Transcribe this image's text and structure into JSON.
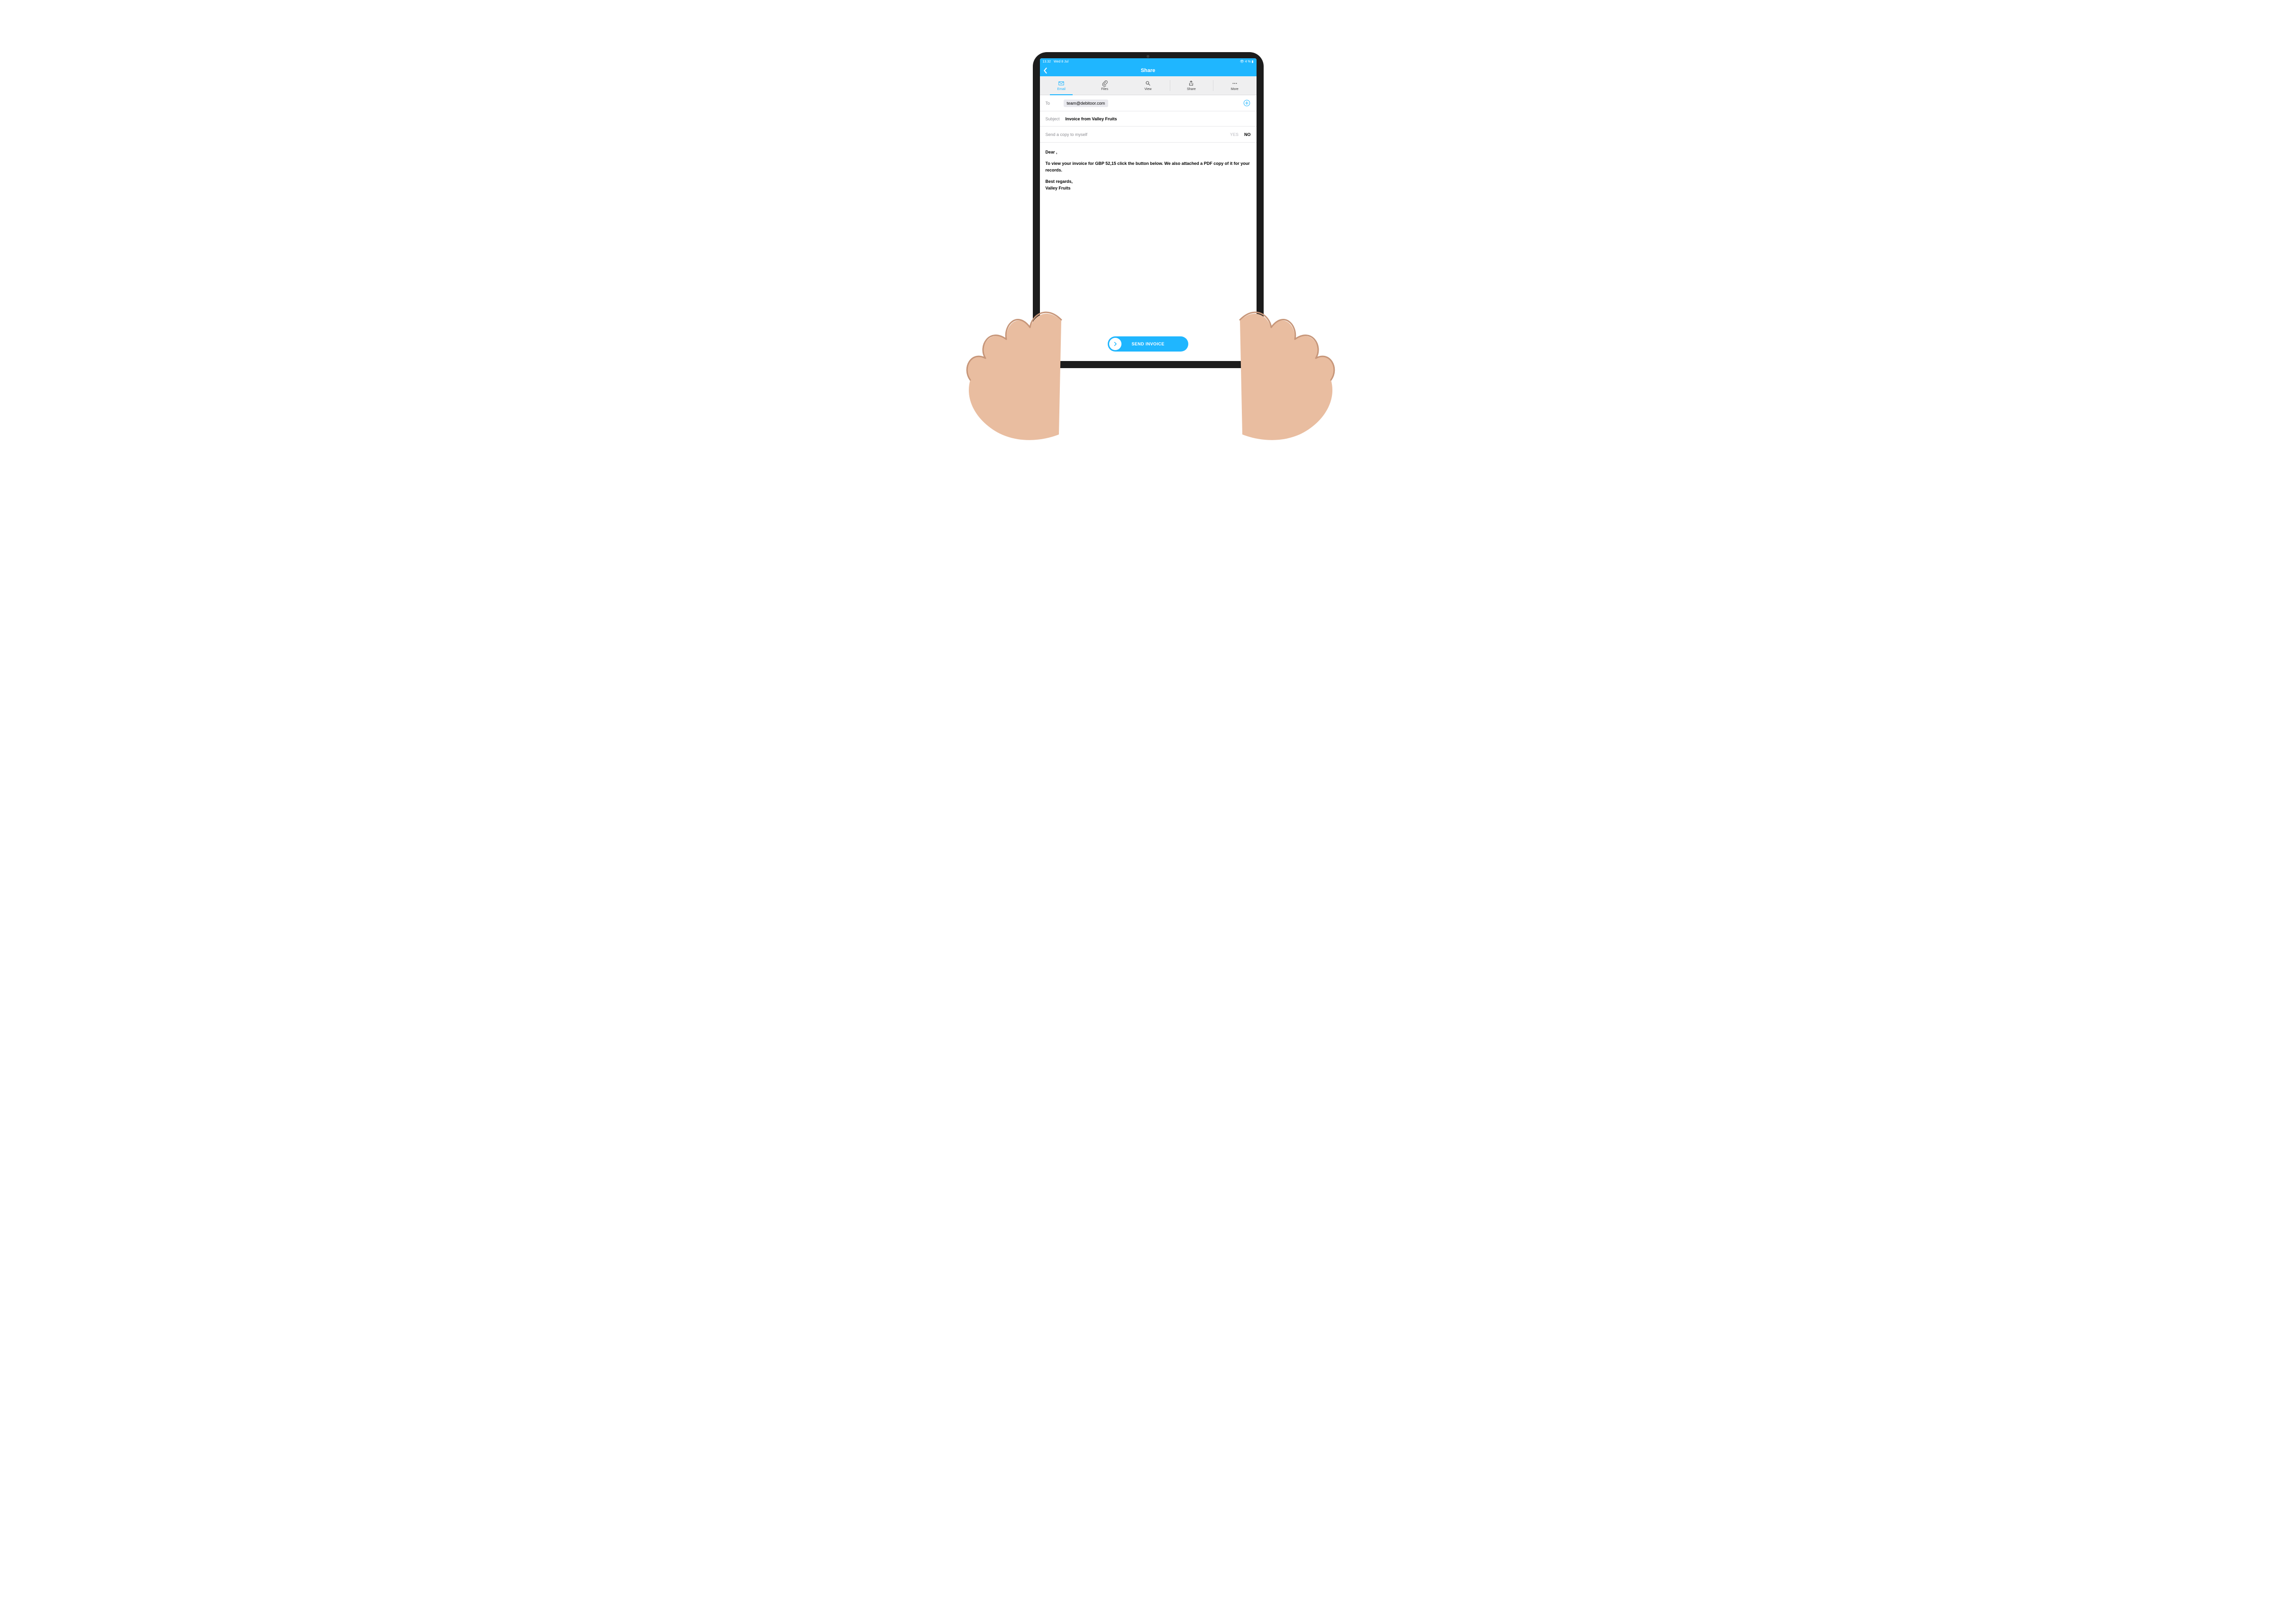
{
  "status": {
    "time": "13.32",
    "date": "Wed 8 Jul",
    "battery": "4 %"
  },
  "nav": {
    "title": "Share"
  },
  "tabs": [
    {
      "icon": "email",
      "label": "Email",
      "active": true
    },
    {
      "icon": "files",
      "label": "Files"
    },
    {
      "icon": "view",
      "label": "View"
    },
    {
      "icon": "share",
      "label": "Share"
    },
    {
      "icon": "more",
      "label": "More"
    }
  ],
  "to": {
    "label": "To",
    "chip": "team@debitoor.com"
  },
  "subject": {
    "label": "Subject",
    "value": "Invoice from Valley Fruits"
  },
  "copy": {
    "label": "Send a copy to myself",
    "yes": "YES",
    "no": "NO"
  },
  "body": {
    "greeting": "Dear ,",
    "line": "To view your invoice for GBP 52,15 click the button below. We also attached a PDF copy of it for your records.",
    "regards": "Best regards,",
    "sender": "Valley Fruits"
  },
  "send": {
    "label": "SEND INVOICE"
  }
}
